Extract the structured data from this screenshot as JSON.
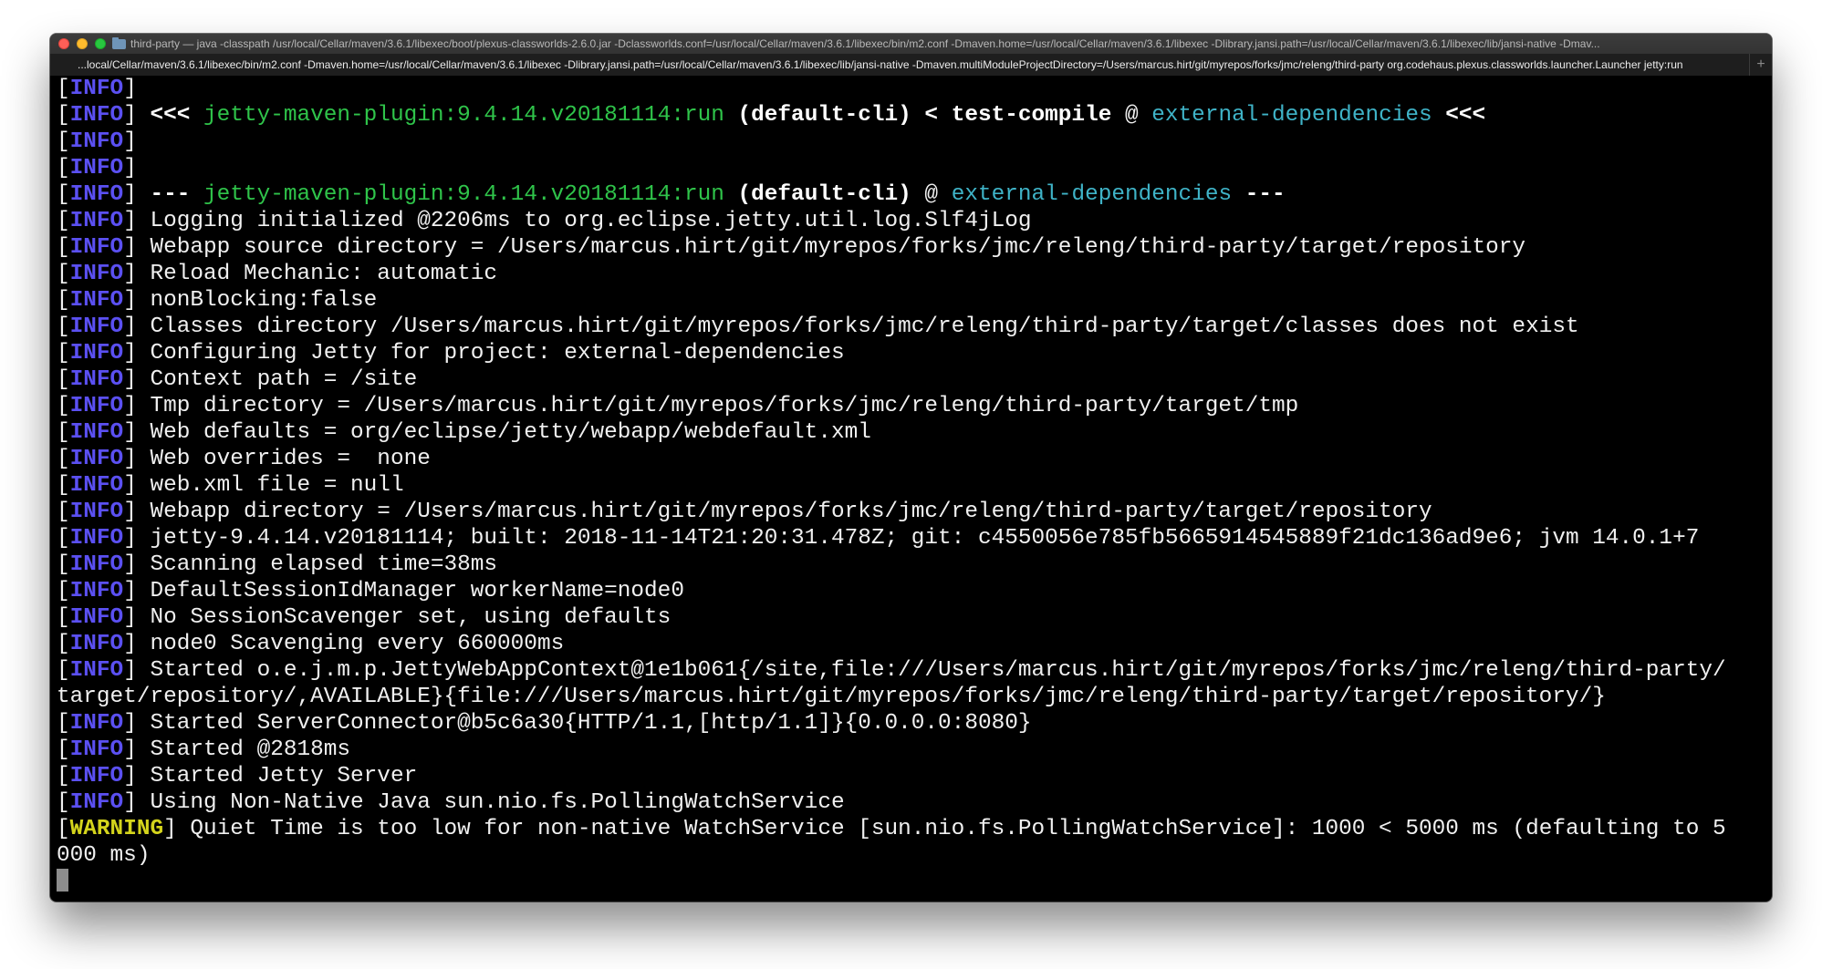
{
  "window": {
    "title": "third-party — java -classpath /usr/local/Cellar/maven/3.6.1/libexec/boot/plexus-classworlds-2.6.0.jar -Dclassworlds.conf=/usr/local/Cellar/maven/3.6.1/libexec/bin/m2.conf -Dmaven.home=/usr/local/Cellar/maven/3.6.1/libexec -Dlibrary.jansi.path=/usr/local/Cellar/maven/3.6.1/libexec/lib/jansi-native -Dmav...",
    "tab_title": "...local/Cellar/maven/3.6.1/libexec/bin/m2.conf -Dmaven.home=/usr/local/Cellar/maven/3.6.1/libexec -Dlibrary.jansi.path=/usr/local/Cellar/maven/3.6.1/libexec/lib/jansi-native -Dmaven.multiModuleProjectDirectory=/Users/marcus.hirt/git/myrepos/forks/jmc/releng/third-party org.codehaus.plexus.classworlds.launcher.Launcher jetty:run",
    "new_tab_label": "+"
  },
  "colors": {
    "info_tag": "#5b50f2",
    "warning_tag": "#d4d41c",
    "plugin_green": "#2fc44a",
    "project_cyan": "#3fb3c7",
    "terminal_bg": "#000000",
    "terminal_fg": "#f0f0f0"
  },
  "lines": [
    {
      "level": "INFO",
      "text": ""
    },
    {
      "level": "INFO",
      "pre": " <<< ",
      "plugin": "jetty-maven-plugin:9.4.14.v20181114:run",
      "bold": " (default-cli) < test-compile",
      "at": " @ ",
      "project": "external-dependencies",
      "post": " <<<"
    },
    {
      "level": "INFO",
      "text": ""
    },
    {
      "level": "INFO",
      "text": ""
    },
    {
      "level": "INFO",
      "pre": " --- ",
      "plugin": "jetty-maven-plugin:9.4.14.v20181114:run",
      "bold": " (default-cli)",
      "at": " @ ",
      "project": "external-dependencies",
      "post": " ---"
    },
    {
      "level": "INFO",
      "text": " Logging initialized @2206ms to org.eclipse.jetty.util.log.Slf4jLog"
    },
    {
      "level": "INFO",
      "text": " Webapp source directory = /Users/marcus.hirt/git/myrepos/forks/jmc/releng/third-party/target/repository"
    },
    {
      "level": "INFO",
      "text": " Reload Mechanic: automatic"
    },
    {
      "level": "INFO",
      "text": " nonBlocking:false"
    },
    {
      "level": "INFO",
      "text": " Classes directory /Users/marcus.hirt/git/myrepos/forks/jmc/releng/third-party/target/classes does not exist"
    },
    {
      "level": "INFO",
      "text": " Configuring Jetty for project: external-dependencies"
    },
    {
      "level": "INFO",
      "text": " Context path = /site"
    },
    {
      "level": "INFO",
      "text": " Tmp directory = /Users/marcus.hirt/git/myrepos/forks/jmc/releng/third-party/target/tmp"
    },
    {
      "level": "INFO",
      "text": " Web defaults = org/eclipse/jetty/webapp/webdefault.xml"
    },
    {
      "level": "INFO",
      "text": " Web overrides =  none"
    },
    {
      "level": "INFO",
      "text": " web.xml file = null"
    },
    {
      "level": "INFO",
      "text": " Webapp directory = /Users/marcus.hirt/git/myrepos/forks/jmc/releng/third-party/target/repository"
    },
    {
      "level": "INFO",
      "text": " jetty-9.4.14.v20181114; built: 2018-11-14T21:20:31.478Z; git: c4550056e785fb5665914545889f21dc136ad9e6; jvm 14.0.1+7"
    },
    {
      "level": "INFO",
      "text": " Scanning elapsed time=38ms"
    },
    {
      "level": "INFO",
      "text": " DefaultSessionIdManager workerName=node0"
    },
    {
      "level": "INFO",
      "text": " No SessionScavenger set, using defaults"
    },
    {
      "level": "INFO",
      "text": " node0 Scavenging every 660000ms"
    },
    {
      "level": "INFO",
      "text": " Started o.e.j.m.p.JettyWebAppContext@1e1b061{/site,file:///Users/marcus.hirt/git/myrepos/forks/jmc/releng/third-party/"
    },
    {
      "level": "",
      "text": "target/repository/,AVAILABLE}{file:///Users/marcus.hirt/git/myrepos/forks/jmc/releng/third-party/target/repository/}"
    },
    {
      "level": "INFO",
      "text": " Started ServerConnector@b5c6a30{HTTP/1.1,[http/1.1]}{0.0.0.0:8080}"
    },
    {
      "level": "INFO",
      "text": " Started @2818ms"
    },
    {
      "level": "INFO",
      "text": " Started Jetty Server"
    },
    {
      "level": "INFO",
      "text": " Using Non-Native Java sun.nio.fs.PollingWatchService"
    },
    {
      "level": "WARNING",
      "text": " Quiet Time is too low for non-native WatchService [sun.nio.fs.PollingWatchService]: 1000 < 5000 ms (defaulting to 5"
    },
    {
      "level": "",
      "text": "000 ms)"
    }
  ]
}
